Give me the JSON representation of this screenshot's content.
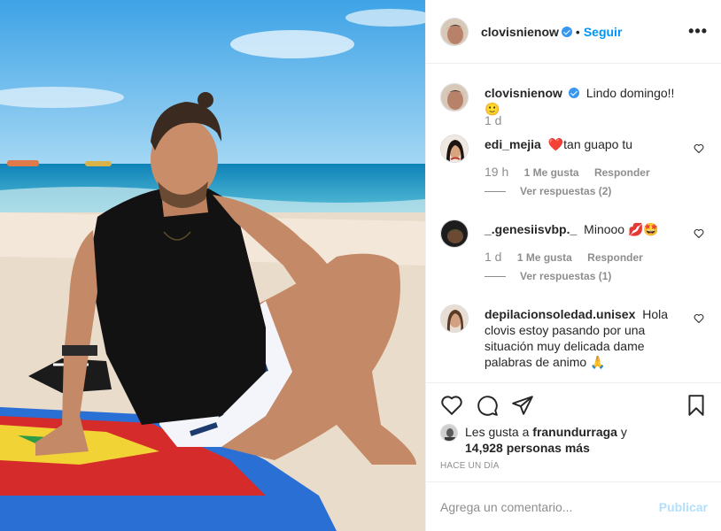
{
  "post": {
    "author": "clovisnienow",
    "follow_label": "Seguir",
    "dot": "•",
    "more_label": "•••"
  },
  "caption": {
    "username": "clovisnienow",
    "text": "Lindo domingo!!🙂",
    "time": "1 d"
  },
  "comments": [
    {
      "username": "edi_mejia",
      "text": "❤️tan guapo tu",
      "time": "19 h",
      "likes": "1 Me gusta",
      "reply_label": "Responder",
      "view_replies": "Ver respuestas (2)"
    },
    {
      "username": "_.genesiisvbp._",
      "text": "Minooo 💋🤩",
      "time": "1 d",
      "likes": "1 Me gusta",
      "reply_label": "Responder",
      "view_replies": "Ver respuestas (1)"
    },
    {
      "username": "depilacionsoledad.unisex",
      "text": "Hola clovis estoy pasando por una situación muy delicada dame palabras de animo 🙏"
    }
  ],
  "likes": {
    "prefix": "Les gusta a ",
    "user": "franundurraga",
    "mid": " y",
    "count": "14,928 personas más"
  },
  "posted_ago": "HACE UN DÍA",
  "add_comment": {
    "placeholder": "Agrega un comentario...",
    "publish_label": "Publicar"
  },
  "colors": {
    "link": "#0095f6",
    "verified": "#3897f0",
    "muted": "#8e8e8e",
    "publish_disabled": "#b2dffc"
  },
  "icons": [
    "more-options-icon",
    "verified-badge-icon",
    "heart-icon",
    "comment-icon",
    "share-icon",
    "bookmark-icon"
  ]
}
